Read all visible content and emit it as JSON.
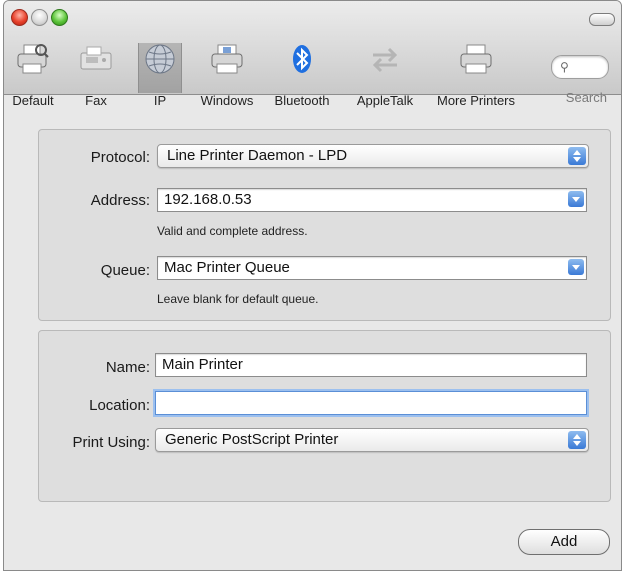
{
  "window": {
    "title": ""
  },
  "toolbar": {
    "items": [
      {
        "label": "Default",
        "icon": "default-printer-icon"
      },
      {
        "label": "Fax",
        "icon": "fax-icon"
      },
      {
        "label": "IP",
        "icon": "ip-globe-icon",
        "selected": true
      },
      {
        "label": "Windows",
        "icon": "windows-printer-icon"
      },
      {
        "label": "Bluetooth",
        "icon": "bluetooth-icon"
      },
      {
        "label": "AppleTalk",
        "icon": "appletalk-icon"
      },
      {
        "label": "More Printers",
        "icon": "more-printers-icon"
      }
    ],
    "search_label": "Search"
  },
  "connection": {
    "protocol_label": "Protocol:",
    "protocol_value": "Line Printer Daemon - LPD",
    "address_label": "Address:",
    "address_value": "192.168.0.53",
    "address_hint": "Valid and complete address.",
    "queue_label": "Queue:",
    "queue_value": "Mac Printer Queue",
    "queue_hint": "Leave blank for default queue."
  },
  "details": {
    "name_label": "Name:",
    "name_value": "Main Printer",
    "location_label": "Location:",
    "location_value": "",
    "print_using_label": "Print Using:",
    "print_using_value": "Generic PostScript Printer"
  },
  "actions": {
    "add_label": "Add"
  },
  "colors": {
    "accent": "#3b7ad6",
    "focus_ring": "#9cc0ef"
  }
}
